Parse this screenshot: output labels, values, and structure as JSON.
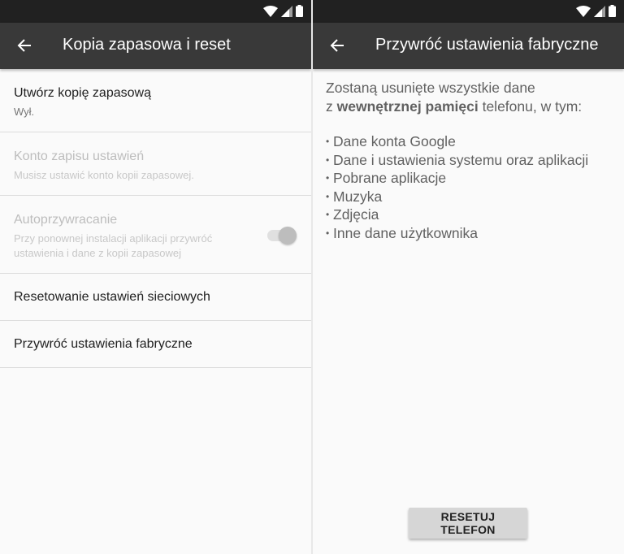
{
  "left": {
    "appbar": {
      "title": "Kopia zapasowa i reset"
    },
    "settings": [
      {
        "title": "Utwórz kopię zapasową",
        "subtitle": "Wył.",
        "enabled": true
      },
      {
        "title": "Konto zapisu ustawień",
        "subtitle": "Musisz ustawić konto kopii zapasowej.",
        "enabled": false
      },
      {
        "title": "Autoprzywracanie",
        "subtitle": "Przy ponownej instalacji aplikacji przywróć ustawienia i dane z kopii zapasowej",
        "enabled": false,
        "toggle_on": false
      },
      {
        "title": "Resetowanie ustawień sieciowych",
        "enabled": true
      },
      {
        "title": "Przywróć ustawienia fabryczne",
        "enabled": true
      }
    ]
  },
  "right": {
    "appbar": {
      "title": "Przywróć ustawienia fabryczne"
    },
    "intro": {
      "line1": "Zostaną usunięte wszystkie dane",
      "line2_prefix": "z ",
      "line2_bold": "wewnętrznej pamięci",
      "line2_suffix": " telefonu, w tym:"
    },
    "bullets": [
      "Dane konta Google",
      "Dane i ustawienia systemu oraz aplikacji",
      "Pobrane aplikacje",
      "Muzyka",
      "Zdjęcia",
      "Inne dane użytkownika"
    ],
    "reset_button": "RESETUJ TELEFON"
  },
  "icons": {
    "back": "arrow-back-icon",
    "wifi": "wifi-icon",
    "signal": "signal-icon",
    "battery": "battery-icon"
  },
  "colors": {
    "status_bar": "#212121",
    "app_bar": "#393939",
    "background": "#fafafa",
    "primary_text": "#212121",
    "disabled_text": "#bdbdbd",
    "button": "#d6d6d6"
  }
}
